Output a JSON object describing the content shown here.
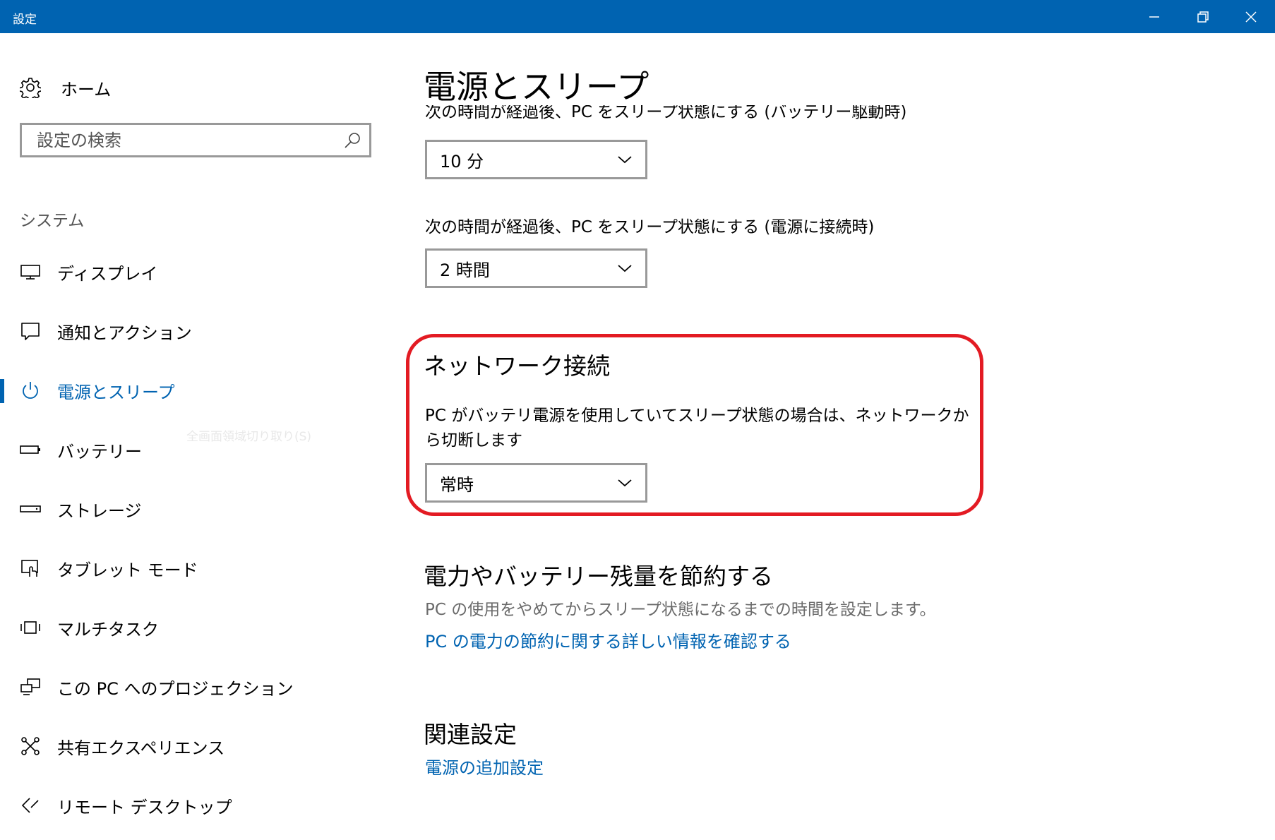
{
  "window": {
    "title": "設定",
    "controls": {
      "minimize": "minimize-icon",
      "restore": "restore-icon",
      "close": "close-icon"
    },
    "accent": "#0063b1"
  },
  "sidebar": {
    "home_label": "ホーム",
    "search_placeholder": "設定の検索",
    "section_title": "システム",
    "items": [
      {
        "label": "ディスプレイ",
        "icon": "display-icon"
      },
      {
        "label": "通知とアクション",
        "icon": "notification-icon"
      },
      {
        "label": "電源とスリープ",
        "icon": "power-icon",
        "active": true
      },
      {
        "label": "バッテリー",
        "icon": "battery-icon"
      },
      {
        "label": "ストレージ",
        "icon": "storage-icon"
      },
      {
        "label": "タブレット モード",
        "icon": "tablet-mode-icon"
      },
      {
        "label": "マルチタスク",
        "icon": "multitask-icon"
      },
      {
        "label": "この PC へのプロジェクション",
        "icon": "projection-icon"
      },
      {
        "label": "共有エクスペリエンス",
        "icon": "shared-experience-icon"
      },
      {
        "label": "リモート デスクトップ",
        "icon": "remote-desktop-icon"
      }
    ],
    "ghost_tooltip": "全画面領域切り取り(S)"
  },
  "main": {
    "title": "電源とスリープ",
    "battery_sleep_label": "次の時間が経過後、PC をスリープ状態にする (バッテリー駆動時)",
    "battery_sleep_value": "10 分",
    "plugged_sleep_label": "次の時間が経過後、PC をスリープ状態にする (電源に接続時)",
    "plugged_sleep_value": "2 時間",
    "network_title": "ネットワーク接続",
    "network_desc": "PC がバッテリ電源を使用していてスリープ状態の場合は、ネットワークから切断します",
    "network_value": "常時",
    "save_title": "電力やバッテリー残量を節約する",
    "save_desc": "PC の使用をやめてからスリープ状態になるまでの時間を設定します。",
    "save_link": "PC の電力の節約に関する詳しい情報を確認する",
    "related_title": "関連設定",
    "related_link": "電源の追加設定"
  },
  "annotation": {
    "color": "#e31b23"
  }
}
